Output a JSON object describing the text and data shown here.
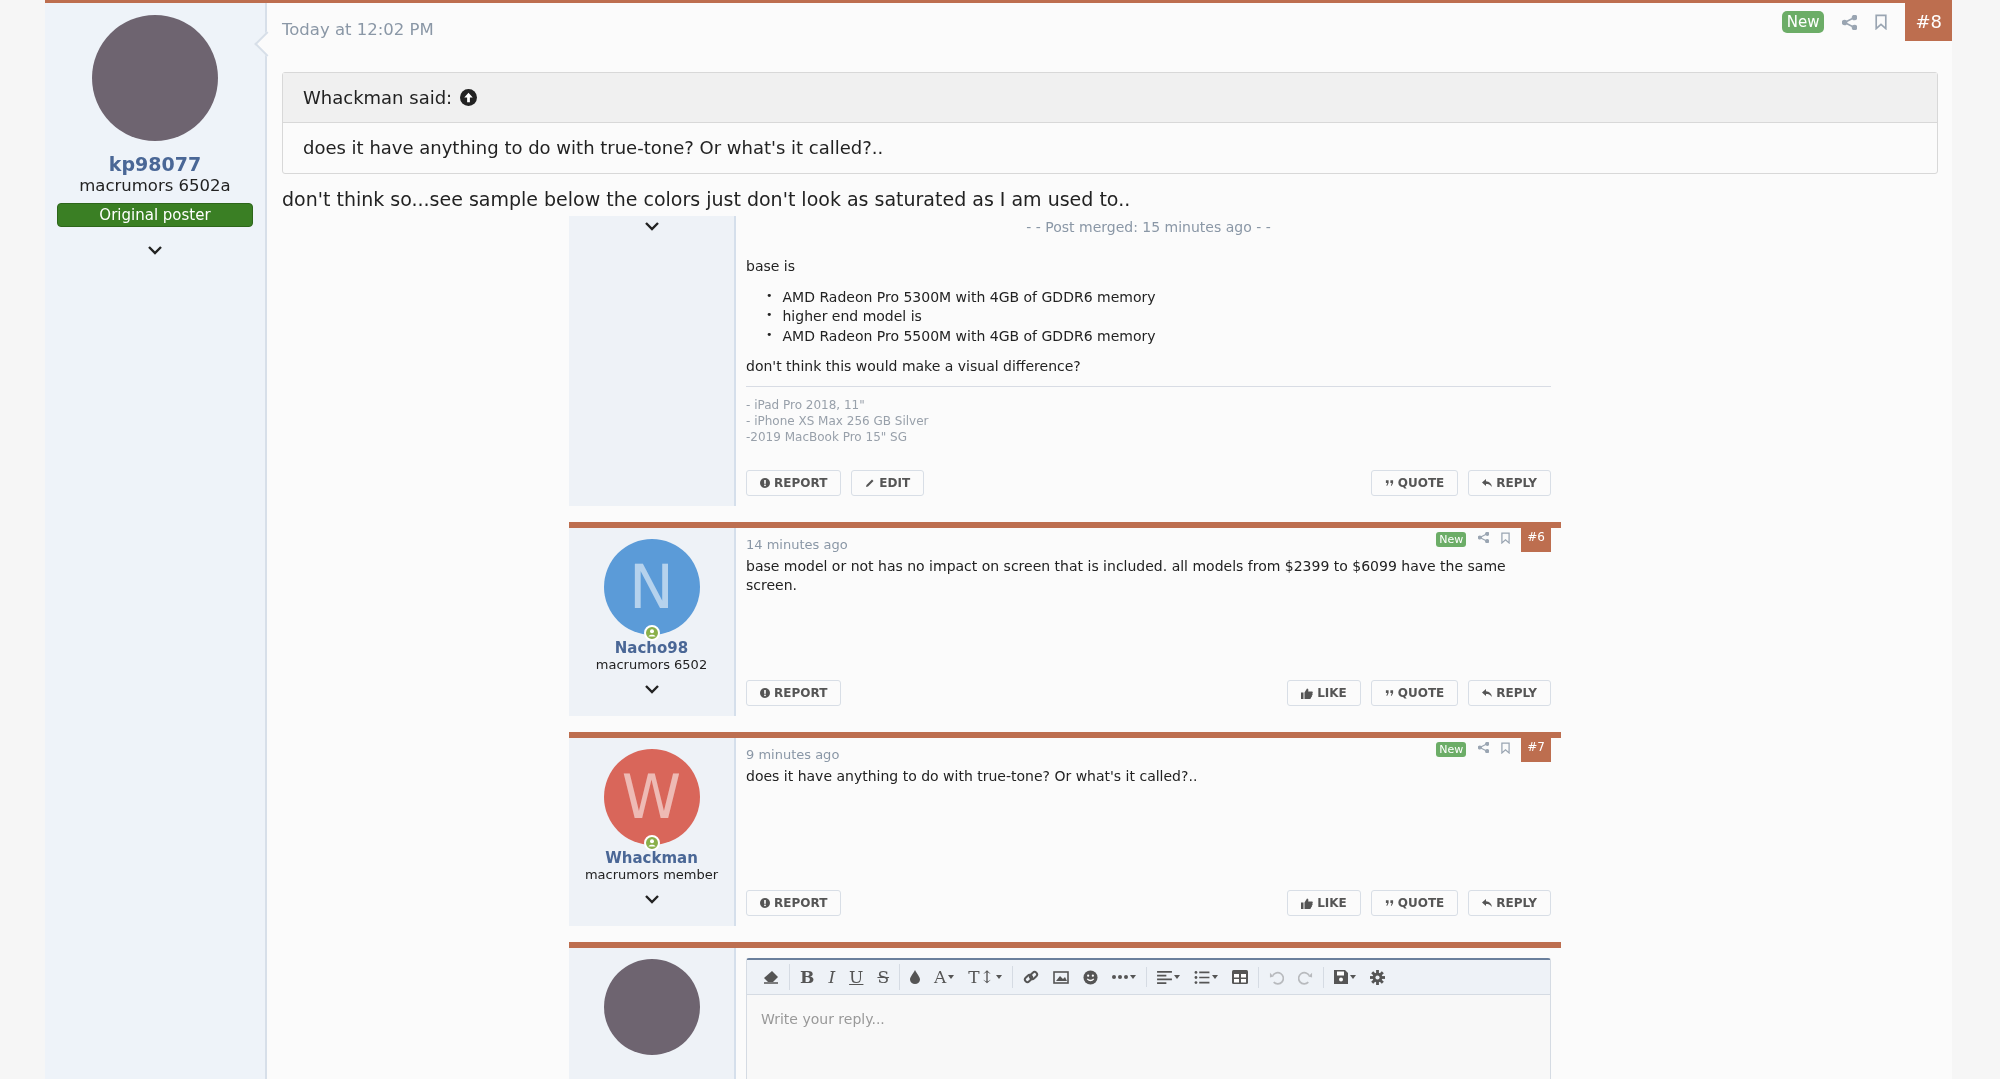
{
  "post": {
    "number": "#8",
    "badge": "New",
    "time": "Today at 12:02 PM",
    "author": {
      "name": "kp98077",
      "rank": "macrumors 6502a",
      "badge": "Original poster"
    },
    "quote": {
      "author": "Whackman said:",
      "text": "does it have anything to do with true-tone? Or what's it called?.."
    },
    "text": "don't think so...see sample below the colors just don't look as saturated as I am used to.."
  },
  "embedded": {
    "partial_post": {
      "merged_note": "- - Post merged: 15 minutes ago - -",
      "intro": "base is",
      "bullets": [
        {
          "marker": "•",
          "text": "AMD Radeon Pro 5300M with 4GB of GDDR6 memory"
        },
        {
          "marker": "•",
          "text": "higher end model is"
        },
        {
          "marker": "•",
          "text": "AMD Radeon Pro 5500M with 4GB of GDDR6 memory"
        }
      ],
      "closing": "don't think this would make a visual difference?",
      "signature": [
        "- iPad Pro 2018, 11\"",
        "- iPhone XS Max 256 GB Silver",
        "-2019 MacBook Pro 15\" SG"
      ],
      "actions_left": [
        {
          "kind": "report",
          "label": "REPORT"
        },
        {
          "kind": "edit",
          "label": "EDIT"
        }
      ],
      "actions_right": [
        {
          "kind": "quote",
          "label": "QUOTE"
        },
        {
          "kind": "reply",
          "label": "REPLY"
        }
      ]
    },
    "posts": [
      {
        "number": "#6",
        "badge": "New",
        "time": "14 minutes ago",
        "author": {
          "initial": "N",
          "color": "#5b9bd8",
          "name": "Nacho98",
          "rank": "macrumors 6502"
        },
        "text": "base model or not has no impact on screen that is included. all models from $2399 to $6099 have the same screen.",
        "actions_left": [
          {
            "kind": "report",
            "label": "REPORT"
          }
        ],
        "actions_right": [
          {
            "kind": "like",
            "label": "LIKE"
          },
          {
            "kind": "quote",
            "label": "QUOTE"
          },
          {
            "kind": "reply",
            "label": "REPLY"
          }
        ]
      },
      {
        "number": "#7",
        "badge": "New",
        "time": "9 minutes ago",
        "author": {
          "initial": "W",
          "color": "#d9665a",
          "name": "Whackman",
          "rank": "macrumors member"
        },
        "text": "does it have anything to do with true-tone? Or what's it called?..",
        "actions_left": [
          {
            "kind": "report",
            "label": "REPORT"
          }
        ],
        "actions_right": [
          {
            "kind": "like",
            "label": "LIKE"
          },
          {
            "kind": "quote",
            "label": "QUOTE"
          },
          {
            "kind": "reply",
            "label": "REPLY"
          }
        ]
      }
    ],
    "reply_box": {
      "placeholder": "Write your reply...",
      "toolbar_groups": [
        {
          "buttons": [
            {
              "kind": "eraser",
              "disabled": false,
              "dropdown": false
            }
          ]
        },
        {
          "buttons": [
            {
              "kind": "letter",
              "label": "B",
              "disabled": false,
              "dropdown": false
            },
            {
              "kind": "letter",
              "label": "I",
              "disabled": false,
              "dropdown": false
            },
            {
              "kind": "letter",
              "label": "U",
              "disabled": false,
              "dropdown": false
            },
            {
              "kind": "letter",
              "label": "S",
              "disabled": false,
              "dropdown": false
            }
          ]
        },
        {
          "buttons": [
            {
              "kind": "drop",
              "disabled": false,
              "dropdown": false
            },
            {
              "kind": "letter",
              "label": "A",
              "disabled": false,
              "dropdown": true
            },
            {
              "kind": "letter",
              "label": "T↕",
              "disabled": false,
              "dropdown": true
            }
          ]
        },
        {
          "buttons": [
            {
              "kind": "link",
              "disabled": false,
              "dropdown": false
            },
            {
              "kind": "image",
              "disabled": false,
              "dropdown": false
            },
            {
              "kind": "smile",
              "disabled": false,
              "dropdown": false
            },
            {
              "kind": "more",
              "disabled": false,
              "dropdown": true
            }
          ]
        },
        {
          "buttons": [
            {
              "kind": "align",
              "disabled": false,
              "dropdown": true
            },
            {
              "kind": "list",
              "disabled": false,
              "dropdown": true
            },
            {
              "kind": "table",
              "disabled": false,
              "dropdown": false
            }
          ]
        },
        {
          "buttons": [
            {
              "kind": "undo",
              "disabled": true,
              "dropdown": false
            },
            {
              "kind": "redo",
              "disabled": true,
              "dropdown": false
            }
          ]
        },
        {
          "buttons": [
            {
              "kind": "save",
              "disabled": false,
              "dropdown": true
            },
            {
              "kind": "gear",
              "disabled": false,
              "dropdown": false
            }
          ]
        }
      ]
    }
  }
}
